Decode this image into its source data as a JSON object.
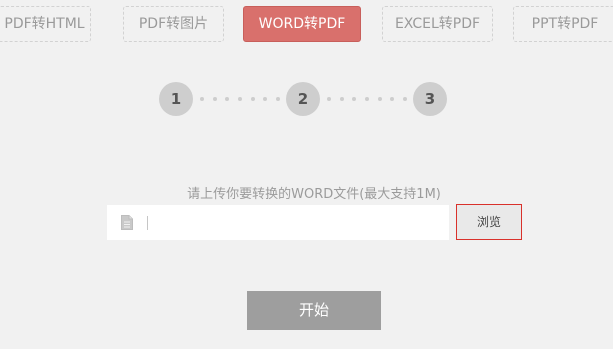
{
  "tabs": [
    {
      "label": "PDF转HTML",
      "active": false
    },
    {
      "label": "PDF转图片",
      "active": false
    },
    {
      "label": "WORD转PDF",
      "active": true
    },
    {
      "label": "EXCEL转PDF",
      "active": false
    },
    {
      "label": "PPT转PDF",
      "active": false
    }
  ],
  "steps": [
    "1",
    "2",
    "3"
  ],
  "upload": {
    "hint": "请上传你要转换的WORD文件(最大支持1M)",
    "value": "",
    "browse_label": "浏览",
    "file_icon": "document-icon"
  },
  "start_label": "开始",
  "colors": {
    "active_tab": "#d9706c",
    "browse_border": "#d9312b",
    "start_button": "#9e9e9e",
    "step_circle": "#cecece"
  }
}
